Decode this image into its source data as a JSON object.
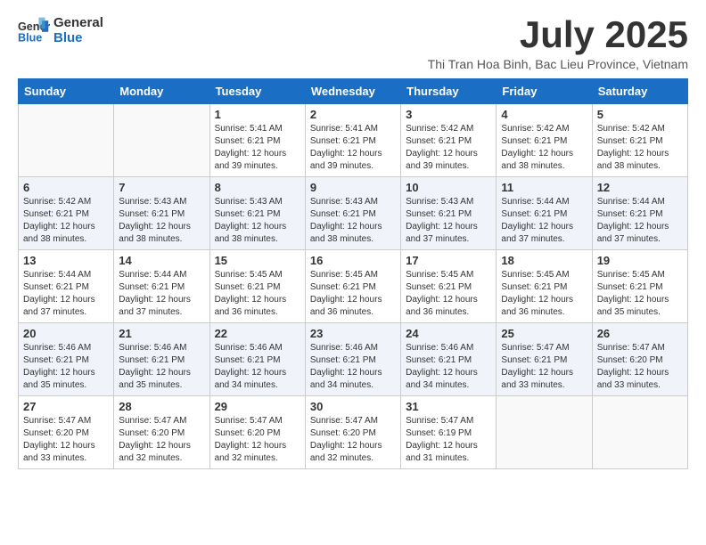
{
  "header": {
    "logo_line1": "General",
    "logo_line2": "Blue",
    "month_title": "July 2025",
    "subtitle": "Thi Tran Hoa Binh, Bac Lieu Province, Vietnam"
  },
  "weekdays": [
    "Sunday",
    "Monday",
    "Tuesday",
    "Wednesday",
    "Thursday",
    "Friday",
    "Saturday"
  ],
  "weeks": [
    [
      {
        "day": "",
        "info": ""
      },
      {
        "day": "",
        "info": ""
      },
      {
        "day": "1",
        "info": "Sunrise: 5:41 AM\nSunset: 6:21 PM\nDaylight: 12 hours and 39 minutes."
      },
      {
        "day": "2",
        "info": "Sunrise: 5:41 AM\nSunset: 6:21 PM\nDaylight: 12 hours and 39 minutes."
      },
      {
        "day": "3",
        "info": "Sunrise: 5:42 AM\nSunset: 6:21 PM\nDaylight: 12 hours and 39 minutes."
      },
      {
        "day": "4",
        "info": "Sunrise: 5:42 AM\nSunset: 6:21 PM\nDaylight: 12 hours and 38 minutes."
      },
      {
        "day": "5",
        "info": "Sunrise: 5:42 AM\nSunset: 6:21 PM\nDaylight: 12 hours and 38 minutes."
      }
    ],
    [
      {
        "day": "6",
        "info": "Sunrise: 5:42 AM\nSunset: 6:21 PM\nDaylight: 12 hours and 38 minutes."
      },
      {
        "day": "7",
        "info": "Sunrise: 5:43 AM\nSunset: 6:21 PM\nDaylight: 12 hours and 38 minutes."
      },
      {
        "day": "8",
        "info": "Sunrise: 5:43 AM\nSunset: 6:21 PM\nDaylight: 12 hours and 38 minutes."
      },
      {
        "day": "9",
        "info": "Sunrise: 5:43 AM\nSunset: 6:21 PM\nDaylight: 12 hours and 38 minutes."
      },
      {
        "day": "10",
        "info": "Sunrise: 5:43 AM\nSunset: 6:21 PM\nDaylight: 12 hours and 37 minutes."
      },
      {
        "day": "11",
        "info": "Sunrise: 5:44 AM\nSunset: 6:21 PM\nDaylight: 12 hours and 37 minutes."
      },
      {
        "day": "12",
        "info": "Sunrise: 5:44 AM\nSunset: 6:21 PM\nDaylight: 12 hours and 37 minutes."
      }
    ],
    [
      {
        "day": "13",
        "info": "Sunrise: 5:44 AM\nSunset: 6:21 PM\nDaylight: 12 hours and 37 minutes."
      },
      {
        "day": "14",
        "info": "Sunrise: 5:44 AM\nSunset: 6:21 PM\nDaylight: 12 hours and 37 minutes."
      },
      {
        "day": "15",
        "info": "Sunrise: 5:45 AM\nSunset: 6:21 PM\nDaylight: 12 hours and 36 minutes."
      },
      {
        "day": "16",
        "info": "Sunrise: 5:45 AM\nSunset: 6:21 PM\nDaylight: 12 hours and 36 minutes."
      },
      {
        "day": "17",
        "info": "Sunrise: 5:45 AM\nSunset: 6:21 PM\nDaylight: 12 hours and 36 minutes."
      },
      {
        "day": "18",
        "info": "Sunrise: 5:45 AM\nSunset: 6:21 PM\nDaylight: 12 hours and 36 minutes."
      },
      {
        "day": "19",
        "info": "Sunrise: 5:45 AM\nSunset: 6:21 PM\nDaylight: 12 hours and 35 minutes."
      }
    ],
    [
      {
        "day": "20",
        "info": "Sunrise: 5:46 AM\nSunset: 6:21 PM\nDaylight: 12 hours and 35 minutes."
      },
      {
        "day": "21",
        "info": "Sunrise: 5:46 AM\nSunset: 6:21 PM\nDaylight: 12 hours and 35 minutes."
      },
      {
        "day": "22",
        "info": "Sunrise: 5:46 AM\nSunset: 6:21 PM\nDaylight: 12 hours and 34 minutes."
      },
      {
        "day": "23",
        "info": "Sunrise: 5:46 AM\nSunset: 6:21 PM\nDaylight: 12 hours and 34 minutes."
      },
      {
        "day": "24",
        "info": "Sunrise: 5:46 AM\nSunset: 6:21 PM\nDaylight: 12 hours and 34 minutes."
      },
      {
        "day": "25",
        "info": "Sunrise: 5:47 AM\nSunset: 6:21 PM\nDaylight: 12 hours and 33 minutes."
      },
      {
        "day": "26",
        "info": "Sunrise: 5:47 AM\nSunset: 6:20 PM\nDaylight: 12 hours and 33 minutes."
      }
    ],
    [
      {
        "day": "27",
        "info": "Sunrise: 5:47 AM\nSunset: 6:20 PM\nDaylight: 12 hours and 33 minutes."
      },
      {
        "day": "28",
        "info": "Sunrise: 5:47 AM\nSunset: 6:20 PM\nDaylight: 12 hours and 32 minutes."
      },
      {
        "day": "29",
        "info": "Sunrise: 5:47 AM\nSunset: 6:20 PM\nDaylight: 12 hours and 32 minutes."
      },
      {
        "day": "30",
        "info": "Sunrise: 5:47 AM\nSunset: 6:20 PM\nDaylight: 12 hours and 32 minutes."
      },
      {
        "day": "31",
        "info": "Sunrise: 5:47 AM\nSunset: 6:19 PM\nDaylight: 12 hours and 31 minutes."
      },
      {
        "day": "",
        "info": ""
      },
      {
        "day": "",
        "info": ""
      }
    ]
  ]
}
